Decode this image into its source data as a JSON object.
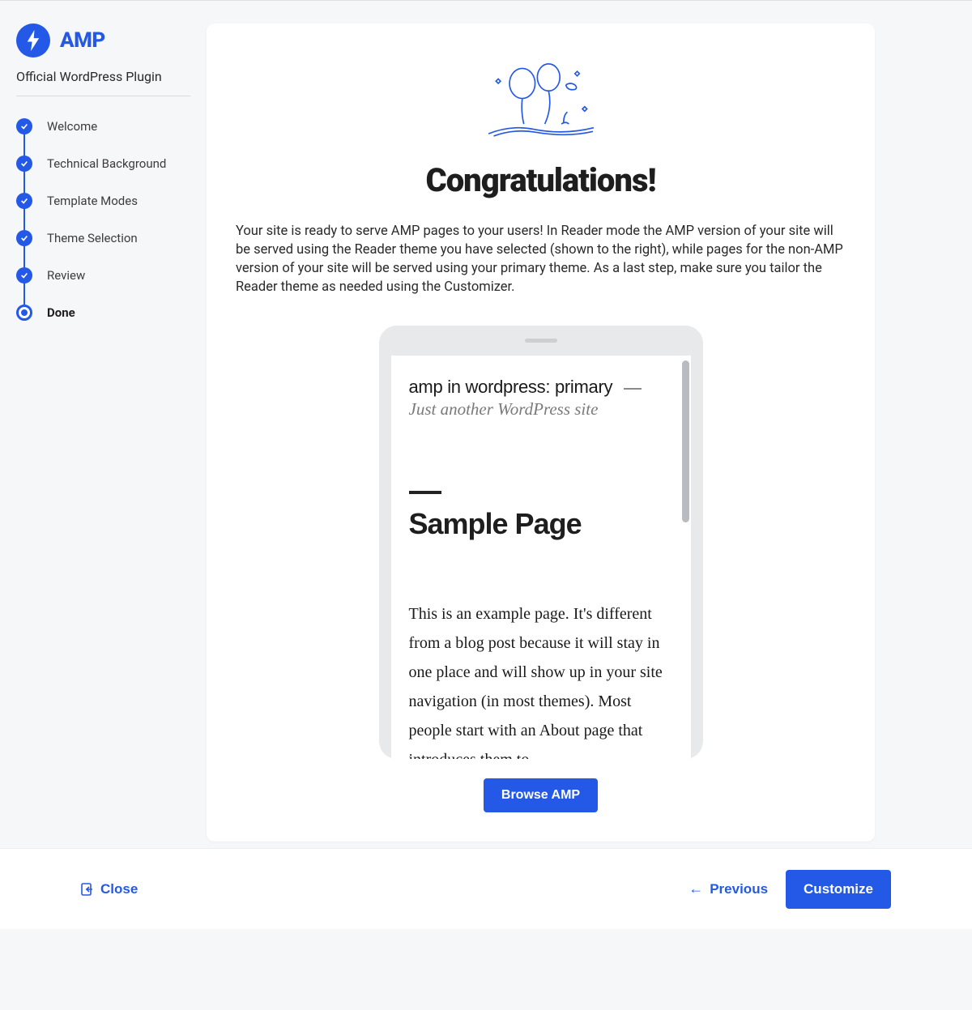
{
  "brand": {
    "name": "AMP",
    "subtitle": "Official WordPress Plugin"
  },
  "steps": [
    {
      "label": "Welcome",
      "state": "done"
    },
    {
      "label": "Technical Background",
      "state": "done"
    },
    {
      "label": "Template Modes",
      "state": "done"
    },
    {
      "label": "Theme Selection",
      "state": "done"
    },
    {
      "label": "Review",
      "state": "done"
    },
    {
      "label": "Done",
      "state": "current"
    }
  ],
  "main": {
    "title": "Congratulations!",
    "body": "Your site is ready to serve AMP pages to your users! In Reader mode the AMP version of your site will be served using the Reader theme you have selected (shown to the right), while pages for the non-AMP version of your site will be served using your primary theme. As a last step, make sure you tailor the Reader theme as needed using the Customizer.",
    "browse_button": "Browse AMP"
  },
  "preview": {
    "site_title": "amp in wordpress: primary",
    "tagline": "Just another WordPress site",
    "page_title": "Sample Page",
    "page_body": "This is an example page. It's different from a blog post because it will stay in one place and will show up in your site navigation (in most themes). Most people start with an About page that introduces them to"
  },
  "footer": {
    "close": "Close",
    "previous": "Previous",
    "customize": "Customize"
  }
}
